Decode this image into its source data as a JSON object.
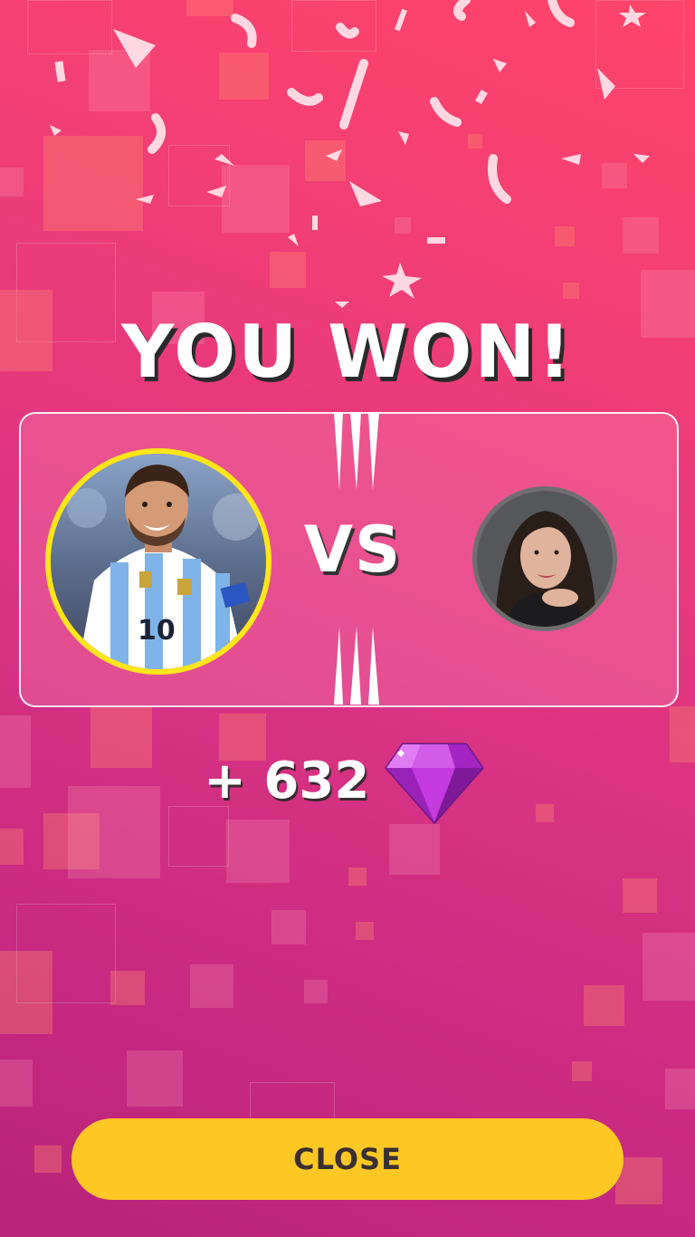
{
  "result": {
    "title": "YOU WON!"
  },
  "match": {
    "vs_label": "VS"
  },
  "reward": {
    "amount_text": "+ 632",
    "icon": "gem-icon"
  },
  "actions": {
    "close_label": "CLOSE"
  },
  "colors": {
    "accent": "#fdc824",
    "winner_ring": "#ffe61a",
    "opponent_ring": "#6e6e6e",
    "gem": "#c63be0"
  }
}
